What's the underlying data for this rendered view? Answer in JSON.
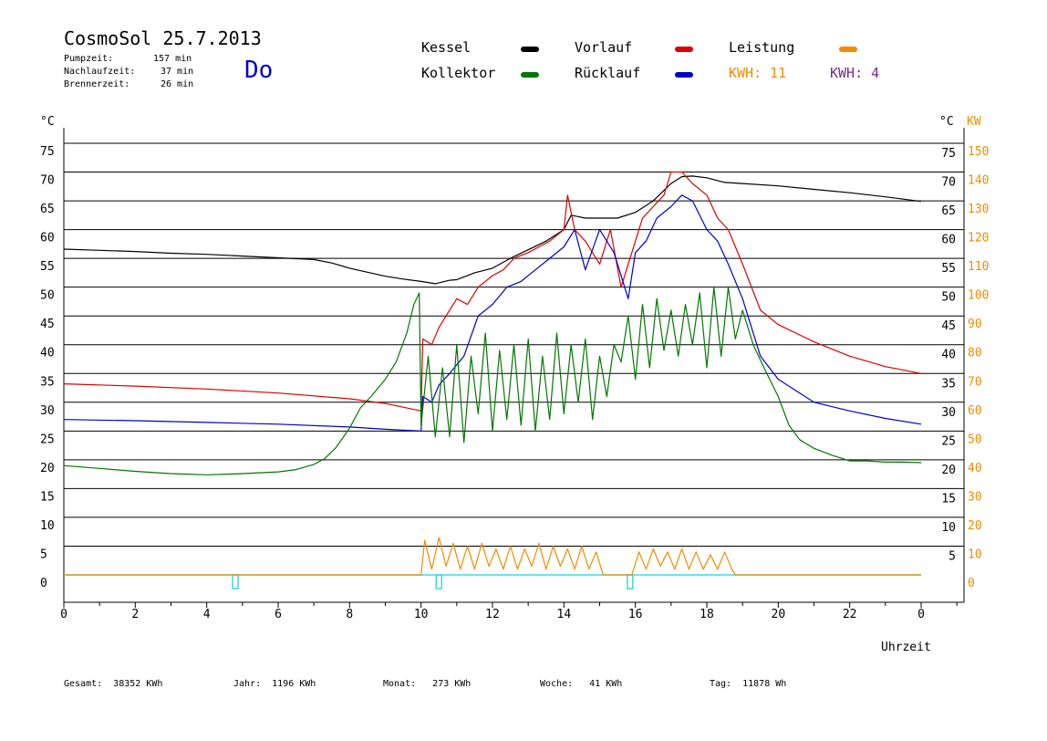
{
  "header": {
    "title": "CosmoSol 25.7.2013",
    "day": "Do",
    "info": [
      {
        "label": "Pumpzeit:",
        "value": "157 min"
      },
      {
        "label": "Nachlaufzeit:",
        "value": "37 min"
      },
      {
        "label": "Brennerzeit:",
        "value": "26 min"
      }
    ]
  },
  "legend": {
    "kessel": "Kessel",
    "kollektor": "Kollektor",
    "vorlauf": "Vorlauf",
    "ruecklauf": "Rücklauf",
    "leistung": "Leistung",
    "kwh1": "KWH: 11",
    "kwh2": "KWH: 4"
  },
  "axes": {
    "left_unit": "°C",
    "right_unit_c": "°C",
    "right_unit_kw": "KW",
    "xlabel": "Uhrzeit"
  },
  "footer": {
    "gesamt": "Gesamt:  38352 KWh",
    "jahr": "Jahr:  1196 KWh",
    "monat": "Monat:   273 KWh",
    "woche": "Woche:   41 KWh",
    "tag": "Tag:  11878 Wh"
  },
  "colors": {
    "kessel": "#000000",
    "kollektor": "#007800",
    "vorlauf": "#dc0000",
    "ruecklauf": "#0000c8",
    "leistung": "#f08c00",
    "kwh2": "#7a2a8c",
    "baseline": "#40d8e0"
  },
  "chart_data": {
    "type": "line",
    "xlabel": "Uhrzeit",
    "ylabel": "°C",
    "xlim": [
      0,
      24
    ],
    "ylim": [
      0,
      75
    ],
    "y2label": "KW",
    "y2lim": [
      0,
      150
    ],
    "x_ticks": [
      0,
      2,
      4,
      6,
      8,
      10,
      12,
      14,
      16,
      18,
      20,
      22,
      0
    ],
    "y_ticks": [
      0,
      5,
      10,
      15,
      20,
      25,
      30,
      35,
      40,
      45,
      50,
      55,
      60,
      65,
      70,
      75
    ],
    "y2_ticks": [
      0,
      10,
      20,
      30,
      40,
      50,
      60,
      70,
      80,
      90,
      100,
      110,
      120,
      130,
      140,
      150
    ],
    "y2_ticks_c": [
      5,
      10,
      15,
      20,
      25,
      30,
      35,
      40,
      45,
      50,
      55,
      60,
      65,
      70,
      75
    ],
    "grid": true,
    "series": [
      {
        "name": "Kessel",
        "color": "#000000",
        "x": [
          0,
          1,
          2,
          3,
          4,
          5,
          6,
          7,
          7.5,
          8,
          8.5,
          9,
          9.5,
          10,
          10.4,
          10.8,
          11,
          11.5,
          12,
          12.5,
          13,
          13.5,
          14,
          14.2,
          14.6,
          15,
          15.5,
          16,
          16.5,
          17,
          17.3,
          17.6,
          18,
          18.5,
          19,
          20,
          21,
          22,
          23,
          24
        ],
        "y": [
          56.6,
          56.4,
          56.2,
          55.9,
          55.7,
          55.4,
          55.1,
          54.8,
          54.2,
          53.3,
          52.6,
          51.9,
          51.4,
          51.0,
          50.6,
          51.2,
          51.3,
          52.5,
          53.3,
          55.0,
          56.5,
          58.0,
          60.0,
          62.5,
          62.0,
          62.0,
          62.0,
          63.0,
          65.0,
          68.0,
          69.2,
          69.3,
          69.0,
          68.2,
          68.0,
          67.6,
          67.0,
          66.4,
          65.7,
          64.9
        ]
      },
      {
        "name": "Vorlauf",
        "color": "#dc0000",
        "x": [
          0,
          2,
          4,
          6,
          8,
          9,
          10,
          10.05,
          10.3,
          10.5,
          10.7,
          11,
          11.3,
          11.6,
          12,
          12.3,
          12.6,
          13,
          13.3,
          13.6,
          14,
          14.1,
          14.3,
          14.6,
          15,
          15.3,
          15.6,
          16,
          16.2,
          16.5,
          16.8,
          17,
          17.3,
          17.6,
          18,
          18.3,
          18.6,
          19,
          19.5,
          20,
          21,
          22,
          23,
          24
        ],
        "y": [
          33.2,
          32.8,
          32.3,
          31.6,
          30.6,
          29.8,
          28.5,
          41.0,
          40.0,
          43.0,
          45.0,
          48.0,
          47.0,
          50.0,
          52.0,
          53.0,
          55.0,
          56.0,
          57.0,
          58.0,
          60.0,
          66.0,
          60.0,
          58.0,
          54.0,
          60.0,
          50.0,
          58.0,
          62.0,
          64.0,
          66.0,
          70.0,
          70.0,
          68.0,
          66.0,
          62.0,
          60.0,
          54.0,
          46.0,
          43.5,
          40.5,
          38.0,
          36.2,
          35.0
        ]
      },
      {
        "name": "Rücklauf",
        "color": "#0000c8",
        "x": [
          0,
          2,
          4,
          6,
          8,
          9,
          10,
          10.05,
          10.3,
          10.5,
          10.8,
          11.2,
          11.6,
          12,
          12.4,
          12.8,
          13.2,
          13.6,
          14,
          14.3,
          14.6,
          15,
          15.4,
          15.8,
          16,
          16.3,
          16.6,
          17,
          17.3,
          17.6,
          18,
          18.3,
          18.6,
          19,
          19.5,
          20,
          21,
          22,
          23,
          24
        ],
        "y": [
          27.0,
          26.8,
          26.5,
          26.2,
          25.7,
          25.3,
          25.0,
          31.0,
          30.0,
          33.0,
          35.0,
          38.0,
          45.0,
          47.0,
          50.0,
          51.0,
          53.0,
          55.0,
          57.0,
          60.0,
          53.0,
          60.0,
          56.0,
          48.0,
          56.0,
          58.0,
          62.0,
          64.0,
          66.0,
          65.0,
          60.0,
          58.0,
          54.0,
          48.0,
          38.0,
          34.0,
          30.0,
          28.5,
          27.2,
          26.2
        ]
      },
      {
        "name": "Kollektor",
        "color": "#007800",
        "x": [
          0,
          1,
          2,
          3,
          4,
          5,
          6,
          6.5,
          7,
          7.3,
          7.6,
          8,
          8.3,
          8.6,
          9,
          9.3,
          9.6,
          9.8,
          9.95,
          10,
          10.2,
          10.4,
          10.6,
          10.8,
          11,
          11.2,
          11.4,
          11.6,
          11.8,
          12,
          12.2,
          12.4,
          12.6,
          12.8,
          13,
          13.2,
          13.4,
          13.6,
          13.8,
          14,
          14.2,
          14.4,
          14.6,
          14.8,
          15,
          15.2,
          15.4,
          15.6,
          15.8,
          16,
          16.2,
          16.4,
          16.6,
          16.8,
          17,
          17.2,
          17.4,
          17.6,
          17.8,
          18,
          18.2,
          18.4,
          18.6,
          18.8,
          19,
          19.3,
          19.6,
          20,
          20.3,
          20.6,
          21,
          21.5,
          22,
          22.5,
          23,
          23.5,
          24
        ],
        "y": [
          19.0,
          18.5,
          18.0,
          17.6,
          17.4,
          17.6,
          17.9,
          18.3,
          19.2,
          20.2,
          22.0,
          25.5,
          29.0,
          31.0,
          34.0,
          37.0,
          42.0,
          47.0,
          49.0,
          26.0,
          38.0,
          24.0,
          36.0,
          24.0,
          40.0,
          23.0,
          38.0,
          28.0,
          42.0,
          25.0,
          39.0,
          27.0,
          40.0,
          26.0,
          41.0,
          25.0,
          38.0,
          27.0,
          42.0,
          28.0,
          40.0,
          30.0,
          41.0,
          27.0,
          38.0,
          31.0,
          40.0,
          37.0,
          45.0,
          34.0,
          47.0,
          36.0,
          48.0,
          39.0,
          46.0,
          38.0,
          47.0,
          40.0,
          49.0,
          36.0,
          50.0,
          38.0,
          50.0,
          41.0,
          46.0,
          40.0,
          36.0,
          31.0,
          26.0,
          23.5,
          22.0,
          20.8,
          19.8,
          19.8,
          19.6,
          19.6,
          19.5
        ]
      },
      {
        "name": "Leistung",
        "color": "#f08c00",
        "axis": "right",
        "x": [
          0,
          10,
          10.1,
          10.3,
          10.5,
          10.7,
          10.9,
          11.1,
          11.3,
          11.5,
          11.7,
          11.9,
          12.1,
          12.3,
          12.5,
          12.7,
          12.9,
          13.1,
          13.3,
          13.5,
          13.7,
          13.9,
          14.1,
          14.3,
          14.5,
          14.7,
          14.9,
          15.1,
          15.9,
          16.1,
          16.3,
          16.5,
          16.7,
          16.9,
          17.1,
          17.3,
          17.5,
          17.7,
          17.9,
          18.1,
          18.3,
          18.5,
          18.7,
          18.8,
          24
        ],
        "y": [
          0,
          0,
          12,
          2,
          13,
          3,
          11,
          2,
          10,
          2,
          11,
          3,
          9,
          2,
          10,
          2,
          9,
          3,
          11,
          2,
          10,
          3,
          9,
          2,
          10,
          2,
          8,
          0,
          0,
          8,
          2,
          9,
          3,
          8,
          2,
          9,
          2,
          8,
          2,
          7,
          2,
          8,
          2,
          0,
          0
        ]
      }
    ],
    "events": [
      4.8,
      10.5,
      15.85
    ]
  }
}
